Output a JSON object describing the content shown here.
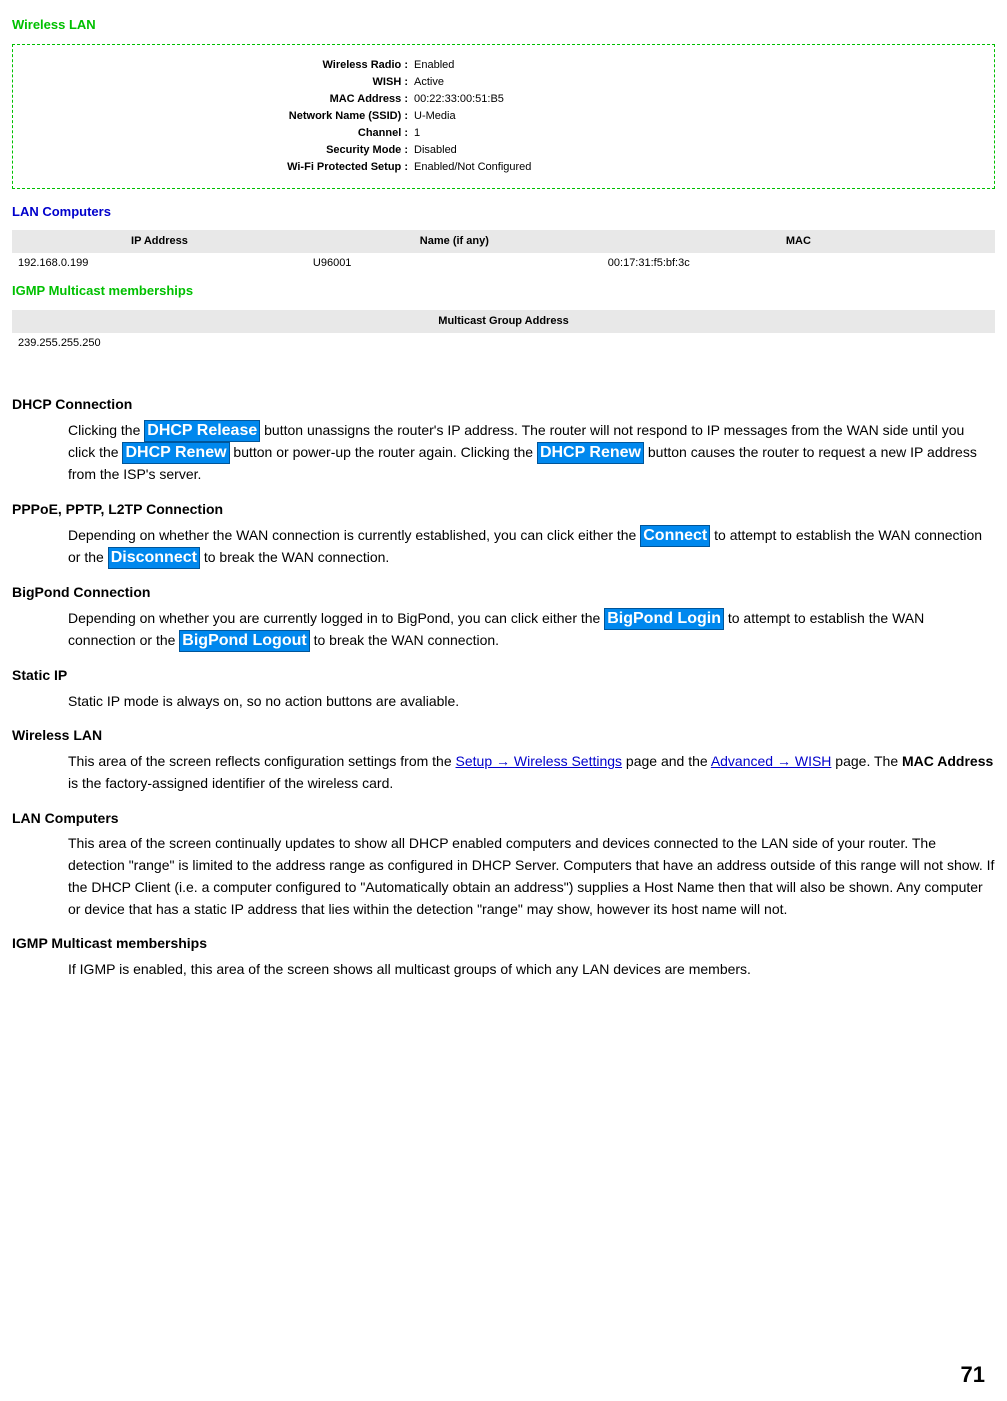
{
  "wireless": {
    "title": "Wireless LAN",
    "rows": [
      {
        "label": "Wireless Radio :",
        "value": "Enabled"
      },
      {
        "label": "WISH :",
        "value": "Active"
      },
      {
        "label": "MAC Address :",
        "value": "00:22:33:00:51:B5"
      },
      {
        "label": "Network Name (SSID) :",
        "value": "U-Media"
      },
      {
        "label": "Channel :",
        "value": "1"
      },
      {
        "label": "Security Mode :",
        "value": "Disabled"
      },
      {
        "label": "Wi-Fi Protected Setup :",
        "value": "Enabled/Not Configured"
      }
    ]
  },
  "lan_computers": {
    "title": "LAN Computers",
    "headers": [
      "IP Address",
      "Name (if any)",
      "MAC"
    ],
    "rows": [
      {
        "ip": "192.168.0.199",
        "name": "U96001",
        "mac": "00:17:31:f5:bf:3c"
      }
    ]
  },
  "igmp": {
    "title": "IGMP Multicast memberships",
    "header": "Multicast Group Address",
    "rows": [
      {
        "addr": "239.255.255.250"
      }
    ]
  },
  "content": {
    "dhcp_title": "DHCP Connection",
    "dhcp_p1a": "Clicking the ",
    "btn_release": "DHCP Release",
    "dhcp_p1b": " button unassigns the router's IP address. The router will not respond to IP messages from the WAN side until you click the ",
    "btn_renew": "DHCP Renew",
    "dhcp_p1c": " button or power-up the router again. Clicking the ",
    "dhcp_p1d": " button causes the router to request a new IP address from the ISP's server.",
    "pppoe_title": "PPPoE, PPTP, L2TP Connection",
    "pppoe_a": "Depending on whether the WAN connection is currently established, you can click either the ",
    "btn_connect": "Connect",
    "pppoe_b": " to attempt to establish the WAN connection or the ",
    "btn_disconnect": "Disconnect",
    "pppoe_c": " to break the WAN connection.",
    "bigpond_title": "BigPond Connection",
    "bigpond_a": "Depending on whether you are currently logged in to BigPond, you can click either the ",
    "btn_bplogin": "BigPond Login",
    "bigpond_b": " to attempt to establish the WAN connection or the ",
    "btn_bplogout": "BigPond Logout",
    "bigpond_c": " to break the WAN connection.",
    "static_title": "Static IP",
    "static_body": "Static IP mode is always on, so no action buttons are avaliable.",
    "wlan_title": "Wireless LAN",
    "wlan_a": "This area of the screen reflects configuration settings from the ",
    "link_wireless": "Setup → Wireless Settings",
    "wlan_b": " page and the ",
    "link_wish": "Advanced → WISH",
    "wlan_c": " page. The ",
    "wlan_mac": "MAC Address",
    "wlan_d": " is the factory-assigned identifier of the wireless card.",
    "lanc_title": "LAN Computers",
    "lanc_body": "This area of the screen continually updates to show all DHCP enabled computers and devices connected to the LAN side of your router. The detection \"range\" is limited to the address range as configured in DHCP Server. Computers that have an address outside of this range will not show. If the DHCP Client (i.e. a computer configured to \"Automatically obtain an address\") supplies a Host Name then that will also be shown. Any computer or device that has a static IP address that lies within the detection \"range\" may show, however its host name will not.",
    "igmp_title": "IGMP Multicast memberships",
    "igmp_body": "If IGMP is enabled, this area of the screen shows all multicast groups of which any LAN devices are members."
  },
  "page_number": "71"
}
